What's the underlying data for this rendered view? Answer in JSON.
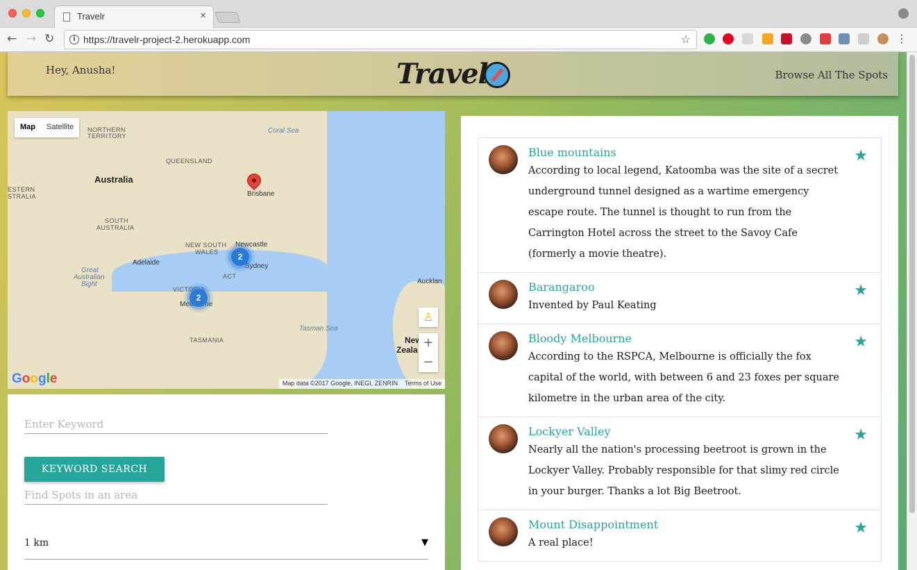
{
  "browser": {
    "tab_title": "Travelr",
    "tab_close": "×",
    "url": "https://travelr-project-2.herokuapp.com",
    "nav": {
      "back": "←",
      "forward": "→",
      "reload": "↻"
    },
    "bookmark_icon": "☆",
    "menu_icon": "⋮"
  },
  "header": {
    "greeting": "Hey, Anusha!",
    "logo_text": "Travelr",
    "browse_link": "Browse All The Spots"
  },
  "map": {
    "type_buttons": [
      "Map",
      "Satellite"
    ],
    "labels": {
      "northern_territory_1": "NORTHERN",
      "northern_territory_2": "TERRITORY",
      "queensland": "QUEENSLAND",
      "australia": "Australia",
      "western_1": "ESTERN",
      "western_2": "STRALIA",
      "south_aus_1": "SOUTH",
      "south_aus_2": "AUSTRALIA",
      "nsw_1": "NEW SOUTH",
      "nsw_2": "WALES",
      "victoria": "VICTORIA",
      "act": "ACT",
      "tasmania": "TASMANIA",
      "coral_sea": "Coral Sea",
      "tasman_sea": "Tasman Sea",
      "bight_1": "Great",
      "bight_2": "Australian",
      "bight_3": "Bight",
      "brisbane": "Brisbane",
      "newcastle": "Newcastle",
      "sydney": "Sydney",
      "adelaide": "Adelaide",
      "melbourne": "Melbourne",
      "auckland": "Aucklan",
      "nz_1": "New",
      "nz_2": "Zeala"
    },
    "clusters": [
      {
        "name": "sydney-cluster",
        "count": "2"
      },
      {
        "name": "melbourne-cluster",
        "count": "2"
      }
    ],
    "zoom_in": "+",
    "zoom_out": "−",
    "pegman_icon": "♙",
    "google": "Google",
    "attribution": "Map data ©2017 Google, INEGI, ZENRIN",
    "terms": "Terms of Use"
  },
  "search": {
    "keyword_placeholder": "Enter Keyword",
    "keyword_button": "KEYWORD SEARCH",
    "area_placeholder": "Find Spots in an area",
    "radius_value": "1 km",
    "radius_arrow": "▼"
  },
  "spots": [
    {
      "title": "Blue mountains",
      "description": "According to local legend, Katoomba was the site of a secret underground tunnel designed as a wartime emergency escape route. The tunnel is thought to run from the Carrington Hotel across the street to the Savoy Cafe (formerly a movie theatre)."
    },
    {
      "title": "Barangaroo",
      "description": "Invented by Paul Keating"
    },
    {
      "title": "Bloody Melbourne",
      "description": "According to the RSPCA, Melbourne is officially the fox capital of the world, with between 6 and 23 foxes per square kilometre in the urban area of the city."
    },
    {
      "title": "Lockyer Valley",
      "description": "Nearly all the nation's processing beetroot is grown in the Lockyer Valley. Probably responsible for that slimy red circle in your burger. Thanks a lot Big Beetroot."
    },
    {
      "title": "Mount Disappointment",
      "description": "A real place!"
    }
  ],
  "star_icon": "★",
  "colors": {
    "accent": "#26a69a",
    "cluster": "#2a7bd8",
    "pin": "#e34234"
  }
}
